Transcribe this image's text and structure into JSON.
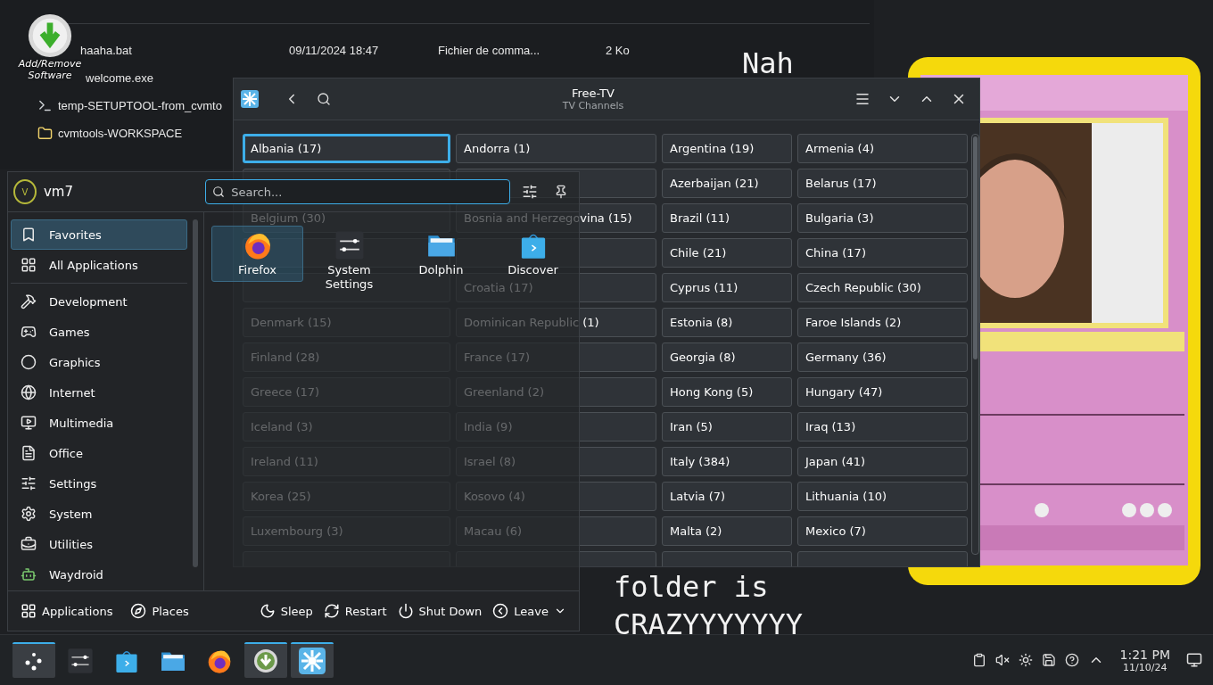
{
  "file_list": {
    "rows": [
      {
        "name": "haaha.bat",
        "date": "09/11/2024 18:47",
        "type": "Fichier de comma...",
        "size": "2 Ko"
      },
      {
        "name": "welcome.exe"
      },
      {
        "name": "temp-SETUPTOOL-from_cvmto"
      },
      {
        "name": "cvmtools-WORKSPACE"
      }
    ]
  },
  "desktop_icon": {
    "label": "Add/Remove Software"
  },
  "meme_text": {
    "top": "Nah",
    "lines": [
      "folder is",
      "CRAZYYYYYYY"
    ]
  },
  "free_tv": {
    "title": "Free-TV",
    "subtitle": "TV Channels",
    "countries": [
      {
        "label": "Albania (17)",
        "selected": true
      },
      {
        "label": "Andorra (1)",
        "selected": false
      },
      {
        "label": "Argentina (19)",
        "selected": false
      },
      {
        "label": "Armenia (4)",
        "selected": false
      },
      {
        "selected": false
      },
      {
        "selected": false
      },
      {
        "label": "Azerbaijan (21)",
        "selected": false
      },
      {
        "label": "Belarus (17)",
        "selected": false
      },
      {
        "label": "Belgium (30)",
        "selected": false
      },
      {
        "label": "Bosnia and Herzegovina (15)",
        "selected": false
      },
      {
        "label": "Brazil (11)",
        "selected": false
      },
      {
        "label": "Bulgaria (3)",
        "selected": false
      },
      {
        "selected": false
      },
      {
        "selected": false
      },
      {
        "label": "Chile (21)",
        "selected": false
      },
      {
        "label": "China (17)",
        "selected": false
      },
      {
        "selected": false
      },
      {
        "label": "Croatia (17)",
        "selected": false
      },
      {
        "label": "Cyprus (11)",
        "selected": false
      },
      {
        "label": "Czech Republic (30)",
        "selected": false
      },
      {
        "label": "Denmark (15)",
        "selected": false
      },
      {
        "label": "Dominican Republic (1)",
        "selected": false
      },
      {
        "label": "Estonia (8)",
        "selected": false
      },
      {
        "label": "Faroe Islands (2)",
        "selected": false
      },
      {
        "label": "Finland (28)",
        "selected": false
      },
      {
        "label": "France (17)",
        "selected": false
      },
      {
        "label": "Georgia (8)",
        "selected": false
      },
      {
        "label": "Germany (36)",
        "selected": false
      },
      {
        "label": "Greece (17)",
        "selected": false
      },
      {
        "label": "Greenland (2)",
        "selected": false
      },
      {
        "label": "Hong Kong (5)",
        "selected": false
      },
      {
        "label": "Hungary (47)",
        "selected": false
      },
      {
        "label": "Iceland (3)",
        "selected": false
      },
      {
        "label": "India (9)",
        "selected": false
      },
      {
        "label": "Iran (5)",
        "selected": false
      },
      {
        "label": "Iraq (13)",
        "selected": false
      },
      {
        "label": "Ireland (11)",
        "selected": false
      },
      {
        "label": "Israel (8)",
        "selected": false
      },
      {
        "label": "Italy (384)",
        "selected": false
      },
      {
        "label": "Japan (41)",
        "selected": false
      },
      {
        "label": "Korea (25)",
        "selected": false
      },
      {
        "label": "Kosovo (4)",
        "selected": false
      },
      {
        "label": "Latvia (7)",
        "selected": false
      },
      {
        "label": "Lithuania (10)",
        "selected": false
      },
      {
        "label": "Luxembourg (3)",
        "selected": false
      },
      {
        "label": "Macau (6)",
        "selected": false
      },
      {
        "label": "Malta (2)",
        "selected": false
      },
      {
        "label": "Mexico (7)",
        "selected": false
      },
      {
        "selected": false
      },
      {
        "selected": false
      },
      {
        "selected": false
      },
      {
        "selected": false
      }
    ]
  },
  "launcher": {
    "user": {
      "initial": "V",
      "name": "vm7"
    },
    "search": {
      "placeholder": "Search..."
    },
    "categories": [
      {
        "label": "Favorites",
        "selected": true
      },
      {
        "label": "All Applications",
        "selected": false
      },
      {
        "label": "Development",
        "selected": false
      },
      {
        "label": "Games",
        "selected": false
      },
      {
        "label": "Graphics",
        "selected": false
      },
      {
        "label": "Internet",
        "selected": false
      },
      {
        "label": "Multimedia",
        "selected": false
      },
      {
        "label": "Office",
        "selected": false
      },
      {
        "label": "Settings",
        "selected": false
      },
      {
        "label": "System",
        "selected": false
      },
      {
        "label": "Utilities",
        "selected": false
      },
      {
        "label": "Waydroid",
        "selected": false
      }
    ],
    "apps": [
      {
        "label": "Firefox",
        "selected": true
      },
      {
        "label": "System Settings",
        "selected": false
      },
      {
        "label": "Dolphin",
        "selected": false
      },
      {
        "label": "Discover",
        "selected": false
      }
    ],
    "footer_tabs": [
      "Applications",
      "Places"
    ],
    "power": [
      "Sleep",
      "Restart",
      "Shut Down",
      "Leave"
    ]
  },
  "taskbar": {
    "items": [
      {
        "active": true
      },
      {
        "active": false
      },
      {
        "active": false
      },
      {
        "active": false
      },
      {
        "active": false
      },
      {
        "active": true
      },
      {
        "active": true
      }
    ],
    "time": "1:21 PM",
    "date": "11/10/24"
  }
}
